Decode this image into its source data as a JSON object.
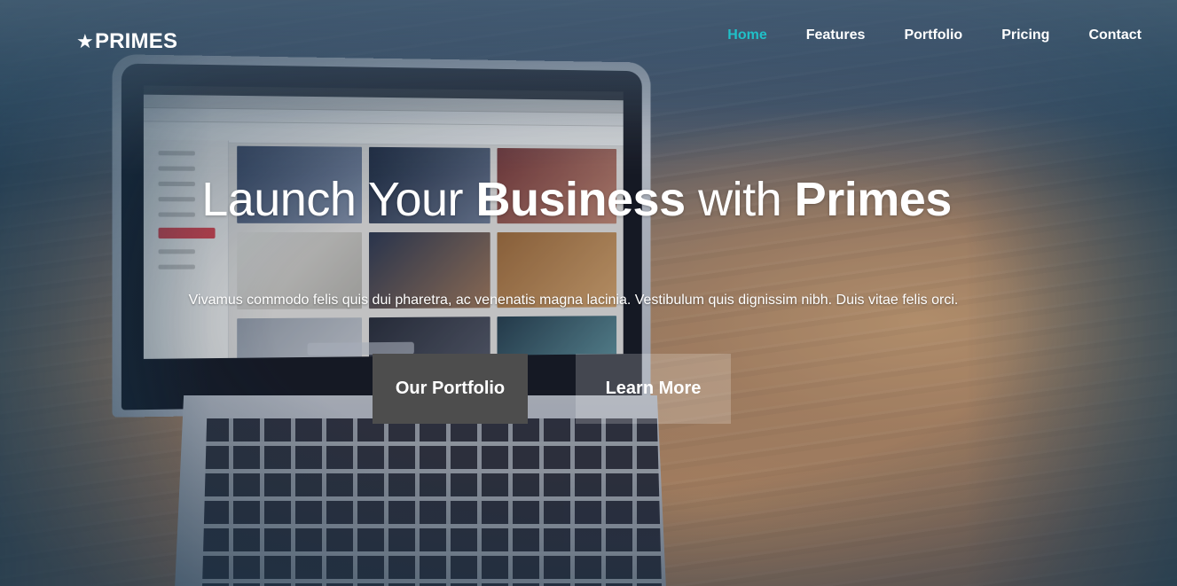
{
  "brand": {
    "logo_text": "PRIMES",
    "logo_icon": "star-icon"
  },
  "nav": {
    "items": [
      {
        "label": "Home",
        "active": true
      },
      {
        "label": "Features",
        "active": false
      },
      {
        "label": "Portfolio",
        "active": false
      },
      {
        "label": "Pricing",
        "active": false
      },
      {
        "label": "Contact",
        "active": false
      }
    ],
    "active_color": "#20c0c8"
  },
  "hero": {
    "title_part1": "Launch Your ",
    "title_bold1": "Business",
    "title_part2": " with ",
    "title_bold2": "Primes",
    "subtitle": "Vivamus commodo felis quis dui pharetra, ac venenatis magna lacinia. Vestibulum quis dignissim nibh. Duis vitae felis orci.",
    "primary_button": "Our Portfolio",
    "secondary_button": "Learn More"
  },
  "colors": {
    "primary_button_bg": "#4d4d4d",
    "secondary_button_bg": "rgba(255,255,255,0.2)"
  }
}
